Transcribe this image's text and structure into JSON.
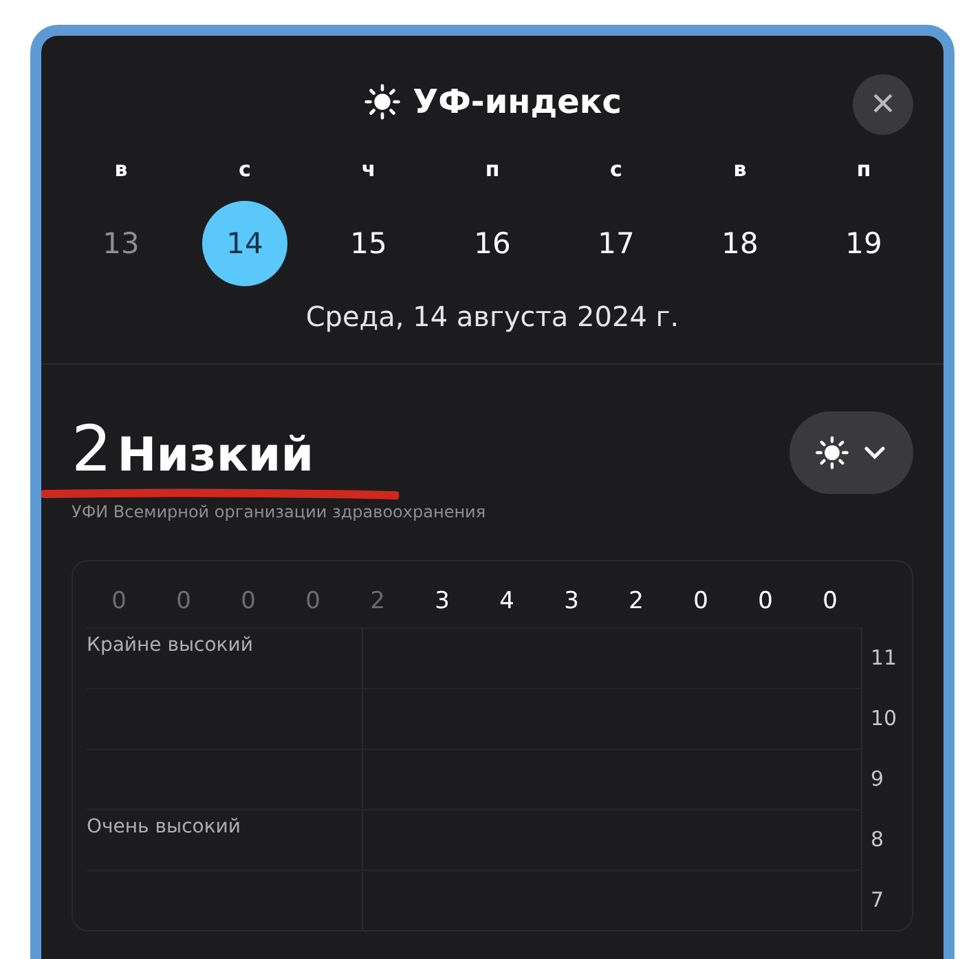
{
  "header": {
    "title": "УФ-индекс",
    "close": "×"
  },
  "week": [
    {
      "letter": "в",
      "date": "13",
      "past": true,
      "selected": false
    },
    {
      "letter": "с",
      "date": "14",
      "past": false,
      "selected": true
    },
    {
      "letter": "ч",
      "date": "15",
      "past": false,
      "selected": false
    },
    {
      "letter": "п",
      "date": "16",
      "past": false,
      "selected": false
    },
    {
      "letter": "с",
      "date": "17",
      "past": false,
      "selected": false
    },
    {
      "letter": "в",
      "date": "18",
      "past": false,
      "selected": false
    },
    {
      "letter": "п",
      "date": "19",
      "past": false,
      "selected": false
    }
  ],
  "full_date": "Среда, 14 августа 2024 г.",
  "summary": {
    "value": "2",
    "level_name": "Низкий",
    "source": "УФИ Всемирной организации здравоохранения"
  },
  "hourly": [
    {
      "value": "0",
      "past": true
    },
    {
      "value": "0",
      "past": true
    },
    {
      "value": "0",
      "past": true
    },
    {
      "value": "0",
      "past": true
    },
    {
      "value": "2",
      "past": true
    },
    {
      "value": "3",
      "past": false
    },
    {
      "value": "4",
      "past": false
    },
    {
      "value": "3",
      "past": false
    },
    {
      "value": "2",
      "past": false
    },
    {
      "value": "0",
      "past": false
    },
    {
      "value": "0",
      "past": false
    },
    {
      "value": "0",
      "past": false
    }
  ],
  "scale": [
    {
      "tick": "11",
      "band": "Крайне высокий"
    },
    {
      "tick": "10"
    },
    {
      "tick": "9"
    },
    {
      "tick": "8",
      "band": "Очень высокий"
    },
    {
      "tick": "7"
    }
  ]
}
